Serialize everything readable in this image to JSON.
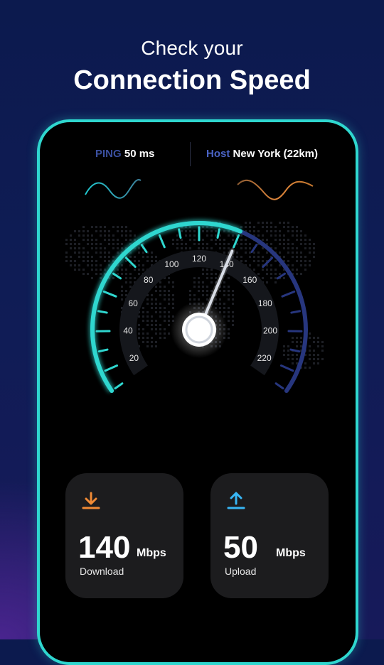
{
  "header": {
    "line1": "Check your",
    "line2": "Connection Speed"
  },
  "stats": {
    "ping_label": "PING",
    "ping_value": "50 ms",
    "host_label": "Host",
    "host_value": "New York (22km)"
  },
  "gauge": {
    "ticks": [
      "20",
      "40",
      "60",
      "80",
      "100",
      "120",
      "140",
      "160",
      "180",
      "200",
      "220"
    ],
    "reading": 140,
    "min": 10,
    "max": 230,
    "colors": {
      "active": "#2fd7cf",
      "inactive": "#27367e",
      "needle": "#d8dde6"
    }
  },
  "cards": {
    "download": {
      "value": "140",
      "unit": "Mbps",
      "label": "Download",
      "icon": "download-icon",
      "icon_color": "#f08a35"
    },
    "upload": {
      "value": "50",
      "unit": "Mbps",
      "label": "Upload",
      "icon": "upload-icon",
      "icon_color": "#38b6f5"
    }
  }
}
